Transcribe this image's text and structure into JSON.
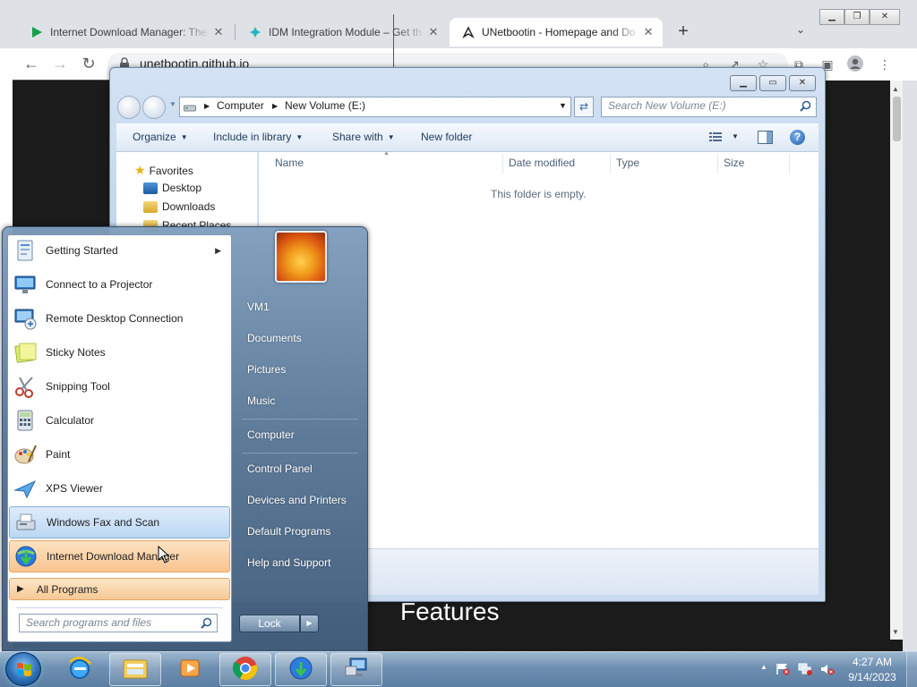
{
  "browser": {
    "tabs": [
      {
        "title": "Internet Download Manager: The",
        "favicon": "green-play-icon",
        "active": false
      },
      {
        "title": "IDM Integration Module – Get th",
        "favicon": "teal-puzzle-icon",
        "active": false
      },
      {
        "title": "UNetbootin - Homepage and Do",
        "favicon": "unetbootin-icon",
        "active": true
      }
    ],
    "url": "unetbootin.github.io",
    "page_heading": "Features"
  },
  "explorer": {
    "breadcrumb": [
      "Computer",
      "New Volume (E:)"
    ],
    "search_placeholder": "Search New Volume (E:)",
    "commands": [
      "Organize",
      "Include in library",
      "Share with",
      "New folder"
    ],
    "nav": {
      "favorites": "Favorites",
      "items": [
        "Desktop",
        "Downloads",
        "Recent Places"
      ]
    },
    "columns": [
      "Name",
      "Date modified",
      "Type",
      "Size"
    ],
    "empty_message": "This folder is empty."
  },
  "start_menu": {
    "programs": [
      {
        "label": "Getting Started",
        "icon": "getting-started-icon",
        "submenu": true
      },
      {
        "label": "Connect to a Projector",
        "icon": "projector-icon"
      },
      {
        "label": "Remote Desktop Connection",
        "icon": "remote-desktop-icon"
      },
      {
        "label": "Sticky Notes",
        "icon": "sticky-notes-icon"
      },
      {
        "label": "Snipping Tool",
        "icon": "snipping-tool-icon"
      },
      {
        "label": "Calculator",
        "icon": "calculator-icon"
      },
      {
        "label": "Paint",
        "icon": "paint-icon"
      },
      {
        "label": "XPS Viewer",
        "icon": "xps-viewer-icon"
      },
      {
        "label": "Windows Fax and Scan",
        "icon": "fax-scan-icon"
      },
      {
        "label": "Internet Download Manager",
        "icon": "idm-icon"
      }
    ],
    "all_programs": "All Programs",
    "search_placeholder": "Search programs and files",
    "right_items": [
      "VM1",
      "Documents",
      "Pictures",
      "Music",
      "Computer",
      "Control Panel",
      "Devices and Printers",
      "Default Programs",
      "Help and Support"
    ],
    "lock_label": "Lock"
  },
  "taskbar": {
    "apps": [
      "internet-explorer-icon",
      "windows-explorer-icon",
      "media-player-icon",
      "chrome-icon",
      "idm-icon",
      "network-icon"
    ],
    "time": "4:27 AM",
    "date": "9/14/2023"
  },
  "colors": {
    "taskbar": "#6e8fb0",
    "start_menu_highlight": "#bcd7f4",
    "start_menu_orange": "#f9c48f",
    "webpage_bg": "#1b1b1b"
  }
}
